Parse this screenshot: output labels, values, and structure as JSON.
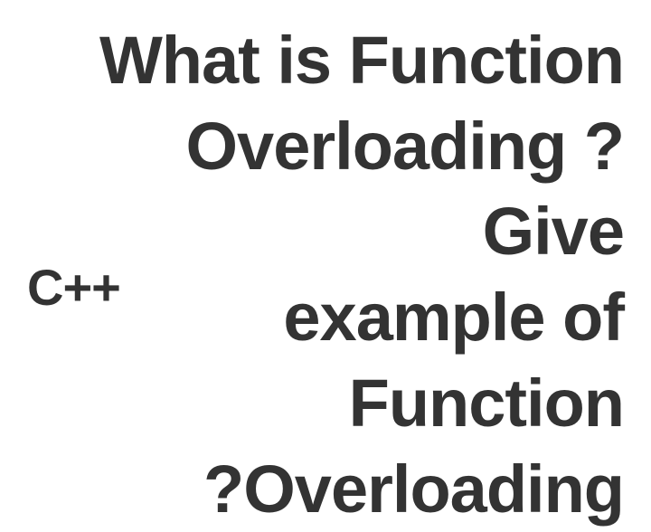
{
  "heading": {
    "line1": "What is Function",
    "line2": "Overloading ? Give",
    "line3": "example of",
    "line4": "Function",
    "line5": "?Overloading"
  },
  "label": "C++"
}
